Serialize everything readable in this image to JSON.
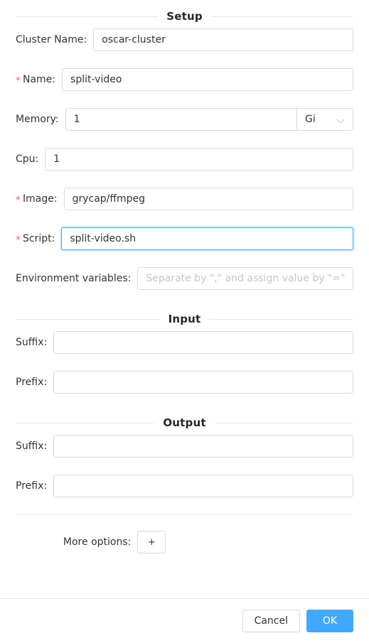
{
  "sections": {
    "setup": {
      "title": "Setup"
    },
    "input": {
      "title": "Input"
    },
    "output": {
      "title": "Output"
    }
  },
  "setup_fields": {
    "cluster_name": {
      "label": "Cluster Name:",
      "value": "oscar-cluster",
      "required": false
    },
    "name": {
      "label": "Name:",
      "value": "split-video",
      "required": true,
      "star": "*"
    },
    "memory": {
      "label": "Memory:",
      "value": "1",
      "required": false,
      "unit": "Gi"
    },
    "cpu": {
      "label": "Cpu:",
      "value": "1",
      "required": false
    },
    "image": {
      "label": "Image:",
      "value": "grycap/ffmpeg",
      "required": true,
      "star": "*"
    },
    "script": {
      "label": "Script:",
      "value": "split-video.sh",
      "required": true,
      "star": "*",
      "focused": true
    },
    "environment_variables": {
      "label": "Environment variables:",
      "value": "",
      "placeholder": "Separate by \",\" and assign value by \"=\""
    }
  },
  "input_fields": {
    "suffix": {
      "label": "Suffix:",
      "value": ""
    },
    "prefix": {
      "label": "Prefix:",
      "value": ""
    }
  },
  "output_fields": {
    "suffix": {
      "label": "Suffix:",
      "value": ""
    },
    "prefix": {
      "label": "Prefix:",
      "value": ""
    }
  },
  "more_options": {
    "label": "More options:",
    "add_label": "+"
  },
  "footer": {
    "cancel_label": "Cancel",
    "ok_label": "OK"
  },
  "colors": {
    "primary": "#40a9ff",
    "required_star": "#f5666c",
    "border": "#d9d9d9",
    "divider": "#e8e8e8",
    "placeholder": "#c6c6c6"
  }
}
